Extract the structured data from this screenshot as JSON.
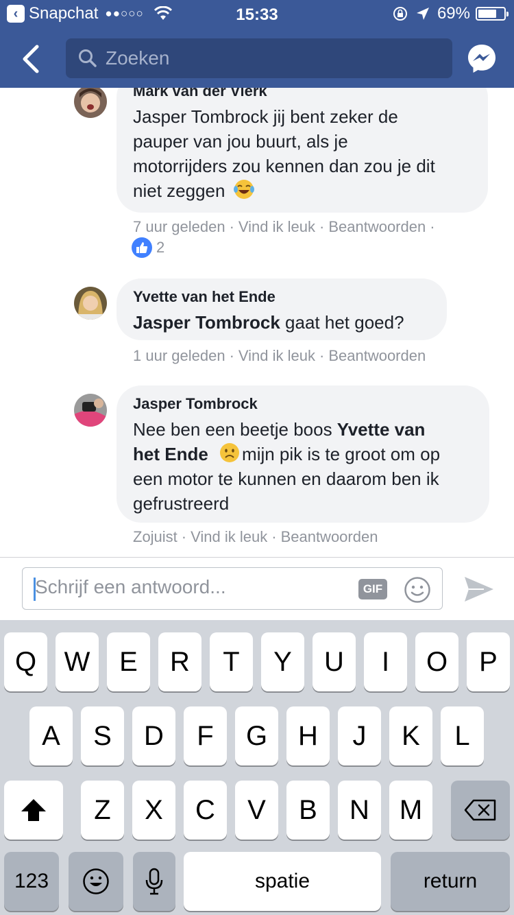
{
  "status_bar": {
    "app": "Snapchat",
    "signal": "●●○○○",
    "time": "15:33",
    "battery": "69%"
  },
  "header": {
    "search_placeholder": "Zoeken"
  },
  "comments": [
    {
      "author": "Mark van der Vlerk",
      "text_lines": [
        "Jasper Tombrock  jij bent zeker de",
        "pauper van jou buurt, als je",
        "motorrijders zou kennen dan zou je dit",
        "niet zeggen"
      ],
      "emoji": "tears-of-joy",
      "time": "7 uur geleden",
      "like": "Vind ik leuk",
      "reply": "Beantwoorden",
      "like_count": "2"
    },
    {
      "author": "Yvette van het Ende",
      "mention": "Jasper Tombrock",
      "text": " gaat het goed?",
      "time": "1 uur geleden",
      "like": "Vind ik leuk",
      "reply": "Beantwoorden"
    },
    {
      "author": "Jasper Tombrock",
      "line1_pre": "Nee ben een beetje boos ",
      "mention_a": "Yvette van",
      "mention_b": "het Ende",
      "line2_post": "mijn pik is te groot om op",
      "line3": "een motor te kunnen en daarom ben ik",
      "line4": "gefrustreerd",
      "emoji": "frowning",
      "time": "Zojuist",
      "like": "Vind ik leuk",
      "reply": "Beantwoorden"
    }
  ],
  "reply_bar": {
    "placeholder": "Schrijf een antwoord...",
    "gif_label": "GIF"
  },
  "keyboard": {
    "row1": [
      "Q",
      "W",
      "E",
      "R",
      "T",
      "Y",
      "U",
      "I",
      "O",
      "P"
    ],
    "row2": [
      "A",
      "S",
      "D",
      "F",
      "G",
      "H",
      "J",
      "K",
      "L"
    ],
    "row3": [
      "Z",
      "X",
      "C",
      "V",
      "B",
      "N",
      "M"
    ],
    "numbers_label": "123",
    "space_label": "spatie",
    "return_label": "return"
  },
  "colors": {
    "brand": "#3b5998",
    "bubble": "#f2f3f5",
    "meta": "#90949c",
    "like": "#4080ff",
    "keyboard_bg": "#d1d5db"
  }
}
